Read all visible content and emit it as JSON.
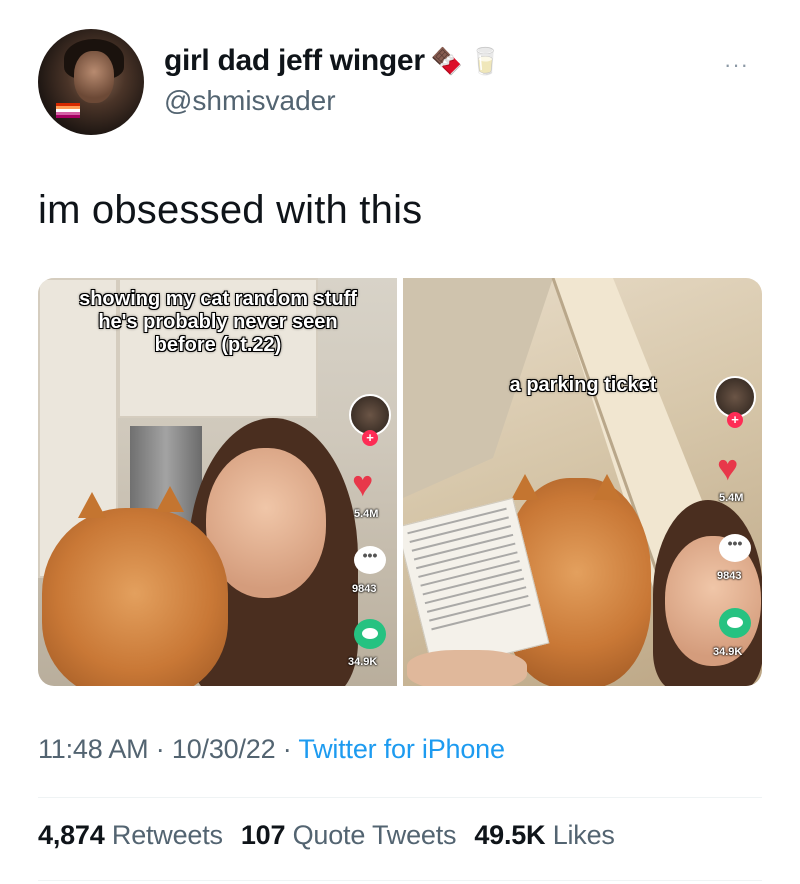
{
  "author": {
    "display_name": "girl dad jeff winger",
    "emoji_1": "🍫",
    "emoji_2": "🥛",
    "handle": "@shmisvader"
  },
  "more_menu": "···",
  "tweet_text": "im obsessed with this",
  "media": {
    "left": {
      "caption": "showing my cat random stuff he's probably never seen before (pt.22)",
      "likes": "5.4M",
      "comments": "9843",
      "shares": "34.9K"
    },
    "right": {
      "caption": "a parking ticket",
      "likes": "5.4M",
      "comments": "9843",
      "shares": "34.9K"
    }
  },
  "meta": {
    "time": "11:48 AM",
    "date": "10/30/22",
    "source": "Twitter for iPhone"
  },
  "stats": {
    "retweets_count": "4,874",
    "retweets_label": "Retweets",
    "quotes_count": "107",
    "quotes_label": "Quote Tweets",
    "likes_count": "49.5K",
    "likes_label": "Likes"
  },
  "colors": {
    "text": "#0f1419",
    "secondary": "#536471",
    "link": "#1d9bf0",
    "tiktok_like": "#e8374a",
    "tiktok_share": "#26c281"
  }
}
